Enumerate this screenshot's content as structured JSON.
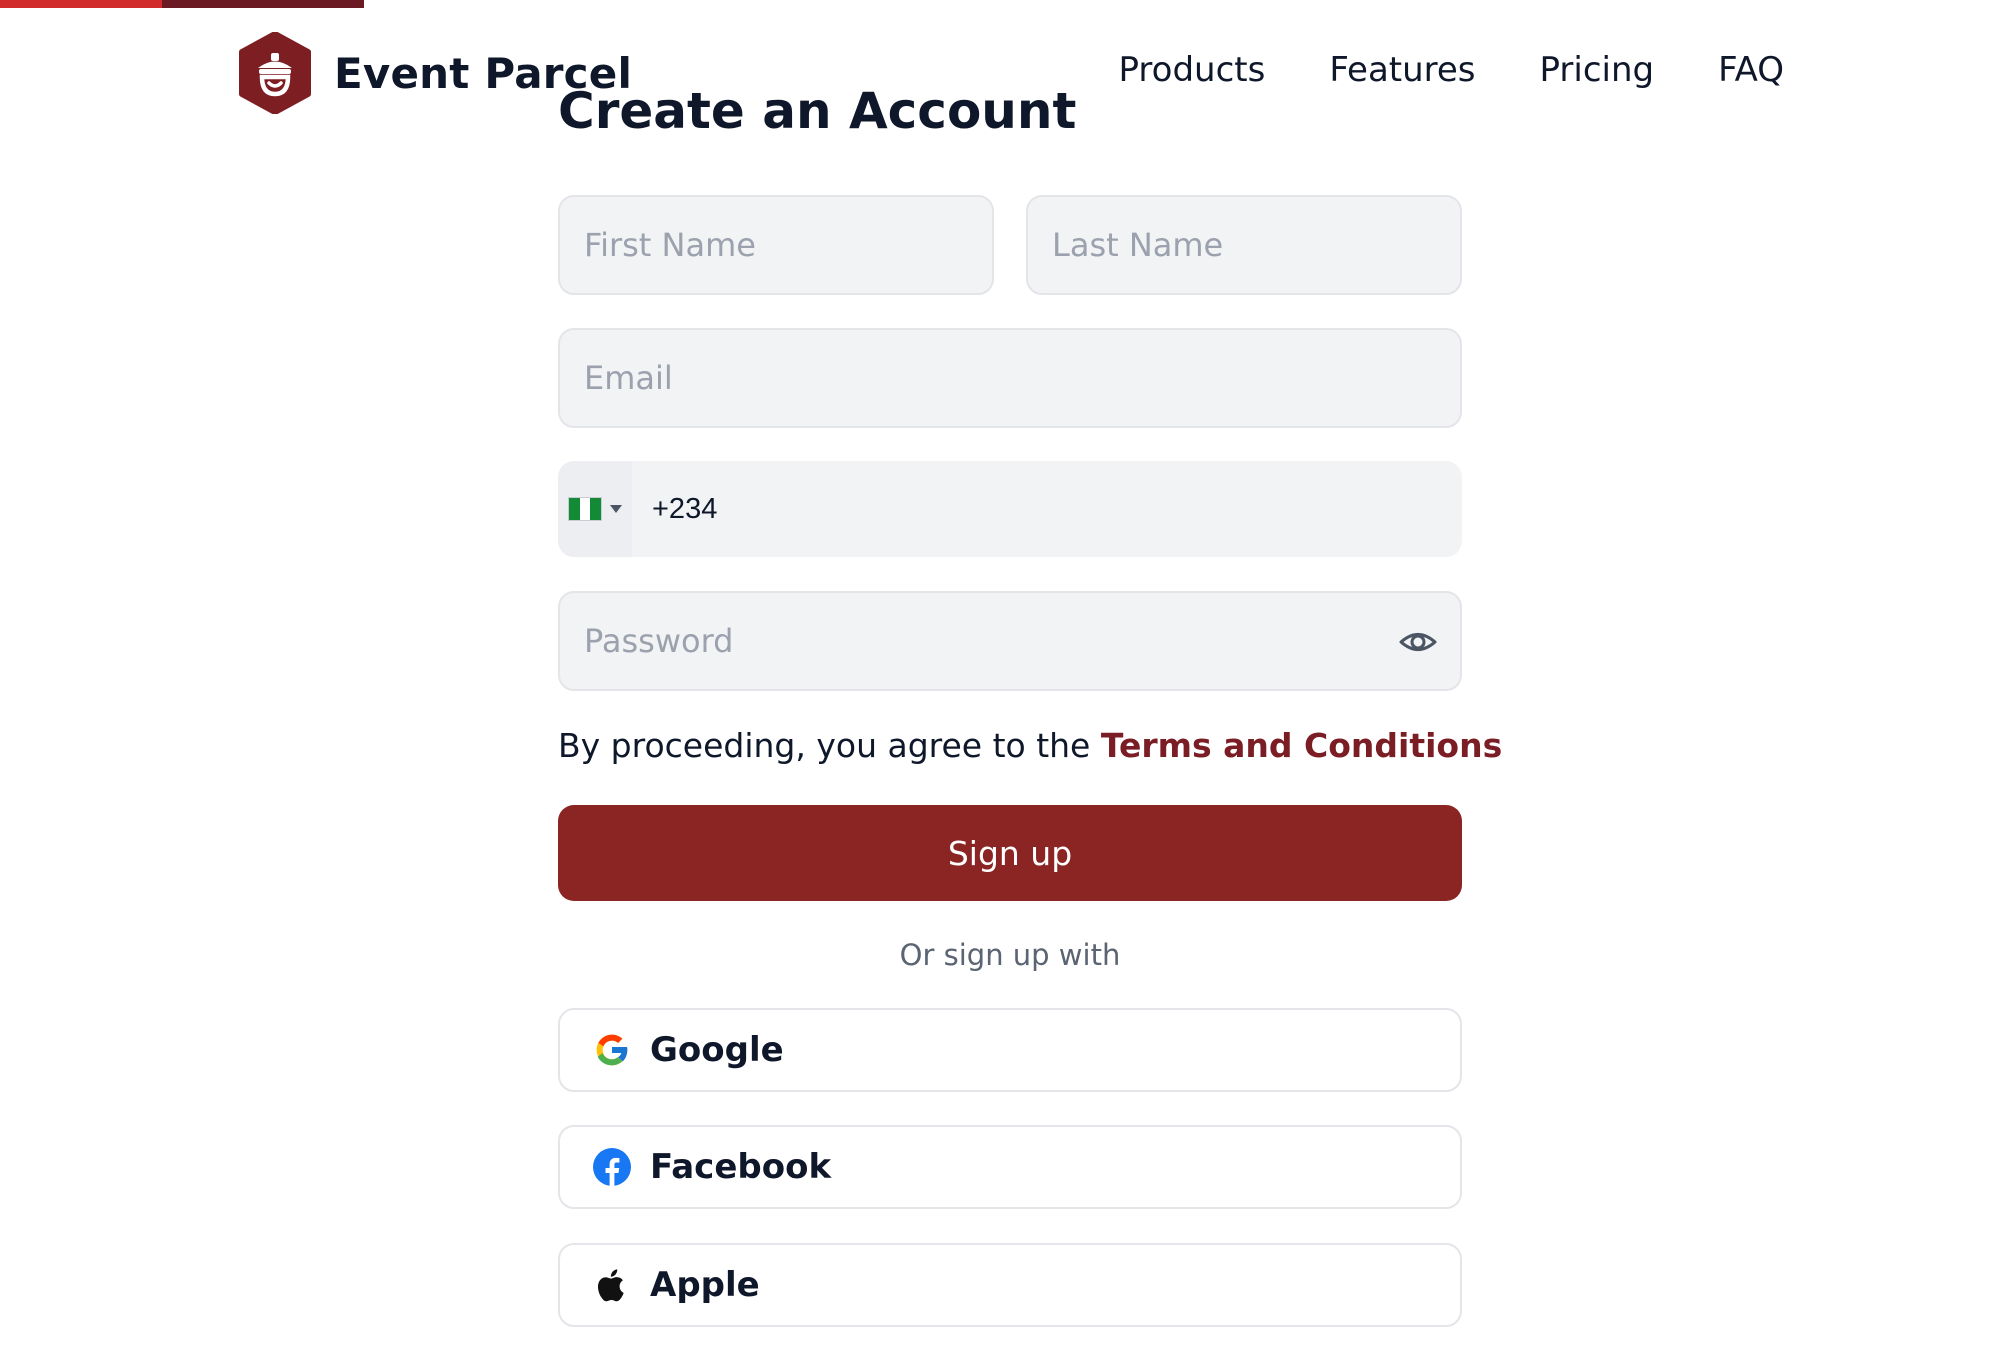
{
  "colors": {
    "brand": "#8b2523",
    "brand_dark": "#7a1d24",
    "progress_bright": "#d12b2b",
    "progress_dark": "#6b1a23",
    "input_bg": "#f2f3f5",
    "text_dark": "#0f172a",
    "text_muted": "#5b6472"
  },
  "header": {
    "brand_name": "Event Parcel",
    "logo_icon": "acorn-hexagon-logo",
    "nav": [
      "Products",
      "Features",
      "Pricing",
      "FAQ"
    ]
  },
  "form": {
    "title": "Create an Account",
    "first_name_placeholder": "First Name",
    "last_name_placeholder": "Last Name",
    "email_placeholder": "Email",
    "phone": {
      "country_flag": "nigeria-flag-icon",
      "value": "+234"
    },
    "password_placeholder": "Password",
    "password_toggle_icon": "eye-icon",
    "terms_prefix": "By proceeding, you agree to the ",
    "terms_link": "Terms and Conditions",
    "submit_label": "Sign up",
    "alt_text": "Or sign up with",
    "social": [
      {
        "label": "Google",
        "icon": "google-icon"
      },
      {
        "label": "Facebook",
        "icon": "facebook-icon"
      },
      {
        "label": "Apple",
        "icon": "apple-icon"
      }
    ]
  },
  "progress_bar": {
    "segments": 2
  }
}
